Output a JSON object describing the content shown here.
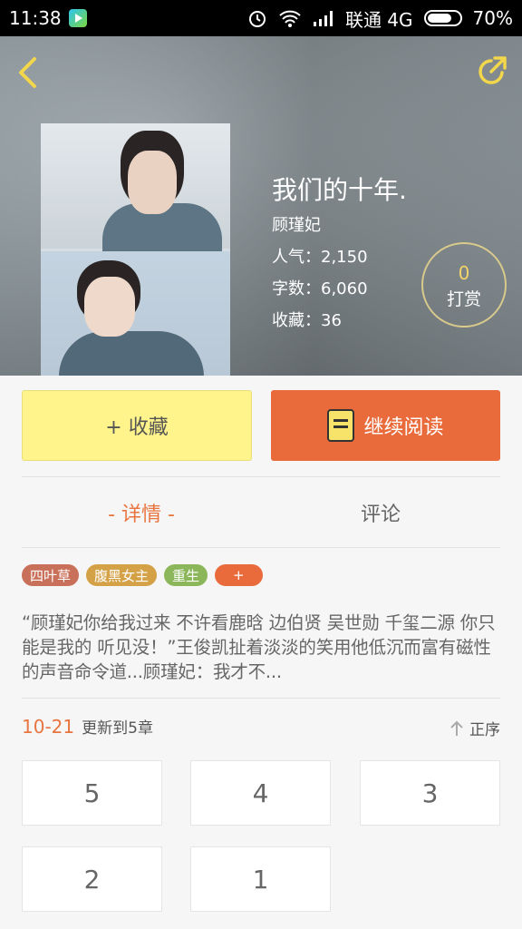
{
  "status_bar": {
    "time": "11:38",
    "carrier": "联通 4G",
    "battery": "70%"
  },
  "book": {
    "title": "我们的十年.",
    "author": "顾瑾妃",
    "popularity": "人气：2,150",
    "words": "字数：6,060",
    "favorites": "收藏：36"
  },
  "tip": {
    "count": "0",
    "label": "打赏"
  },
  "actions": {
    "favorite_label": "+ 收藏",
    "read_label": "继续阅读"
  },
  "tabs": [
    {
      "label": "- 详情 -",
      "active": true
    },
    {
      "label": "评论",
      "active": false
    }
  ],
  "tags": [
    {
      "label": "四叶草",
      "color": "#c9705a"
    },
    {
      "label": "腹黑女主",
      "color": "#d4a146"
    },
    {
      "label": "重生",
      "color": "#8bb75a"
    },
    {
      "label": "+",
      "color": "#e96b3b"
    }
  ],
  "description": "“顾瑾妃你给我过来 不许看鹿晗 边伯贤 吴世勋 千玺二源 你只能是我的 听见没！”王俊凯扯着淡淡的笑用他低沉而富有磁性的声音命令道...顾瑾妃：我才不...",
  "update": {
    "date": "10-21",
    "text": "更新到5章",
    "order_label": "正序"
  },
  "chapters": [
    "5",
    "4",
    "3",
    "2",
    "1"
  ]
}
